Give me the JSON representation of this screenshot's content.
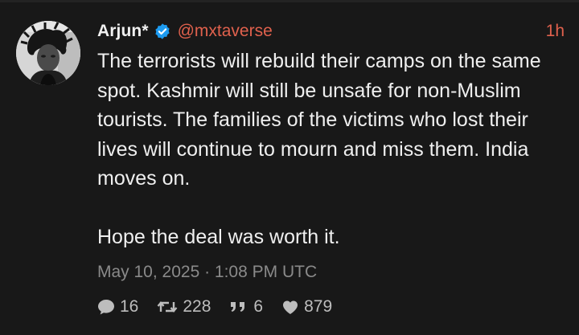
{
  "tweet": {
    "author": {
      "display_name": "Arjun*",
      "handle": "@mxtaverse",
      "verified": true,
      "avatar_icon": "avatar-photo"
    },
    "time_ago": "1h",
    "text_paragraphs": [
      "The terrorists will rebuild their camps on the same spot. Kashmir will still be unsafe for non-Muslim tourists. The families of the victims who lost their lives will continue to mourn and miss them. India moves on.",
      "Hope the deal was worth it."
    ],
    "timestamp": "May 10, 2025 · 1:08 PM UTC",
    "stats": {
      "replies": "16",
      "retweets": "228",
      "quotes": "6",
      "likes": "879"
    }
  },
  "colors": {
    "background": "#181818",
    "accent": "#e0614d",
    "verified_badge": "#1d9bf0",
    "muted_text": "#8a8a8a"
  },
  "icons": {
    "verified": "verified-badge-icon",
    "reply": "comment-icon",
    "retweet": "retweet-icon",
    "quote": "quote-icon",
    "like": "heart-icon"
  }
}
